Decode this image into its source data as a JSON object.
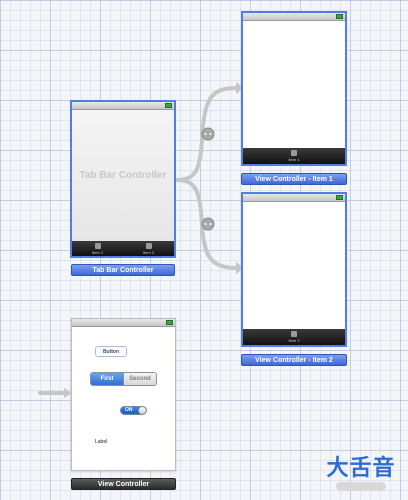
{
  "tab_bar_controller": {
    "placeholder_title": "Tab Bar Controller",
    "tabs": [
      {
        "label": "Item 1"
      },
      {
        "label": "Item 2"
      }
    ],
    "caption": "Tab Bar Controller"
  },
  "item1_scene": {
    "tab_label": "Item 1",
    "caption": "View Controller - Item 1"
  },
  "item2_scene": {
    "tab_label": "Item 2",
    "caption": "View Controller - Item 2"
  },
  "view_controller": {
    "button_label": "Button",
    "segments": [
      {
        "label": "First",
        "selected": true
      },
      {
        "label": "Second",
        "selected": false
      }
    ],
    "switch_state": "ON",
    "label_text": "Label",
    "caption": "View Controller"
  },
  "watermark": {
    "text": "大舌音"
  },
  "colors": {
    "selection": "#4f7ee8",
    "segue": "#c8c8c8",
    "label_bar": "#3f68d6"
  }
}
